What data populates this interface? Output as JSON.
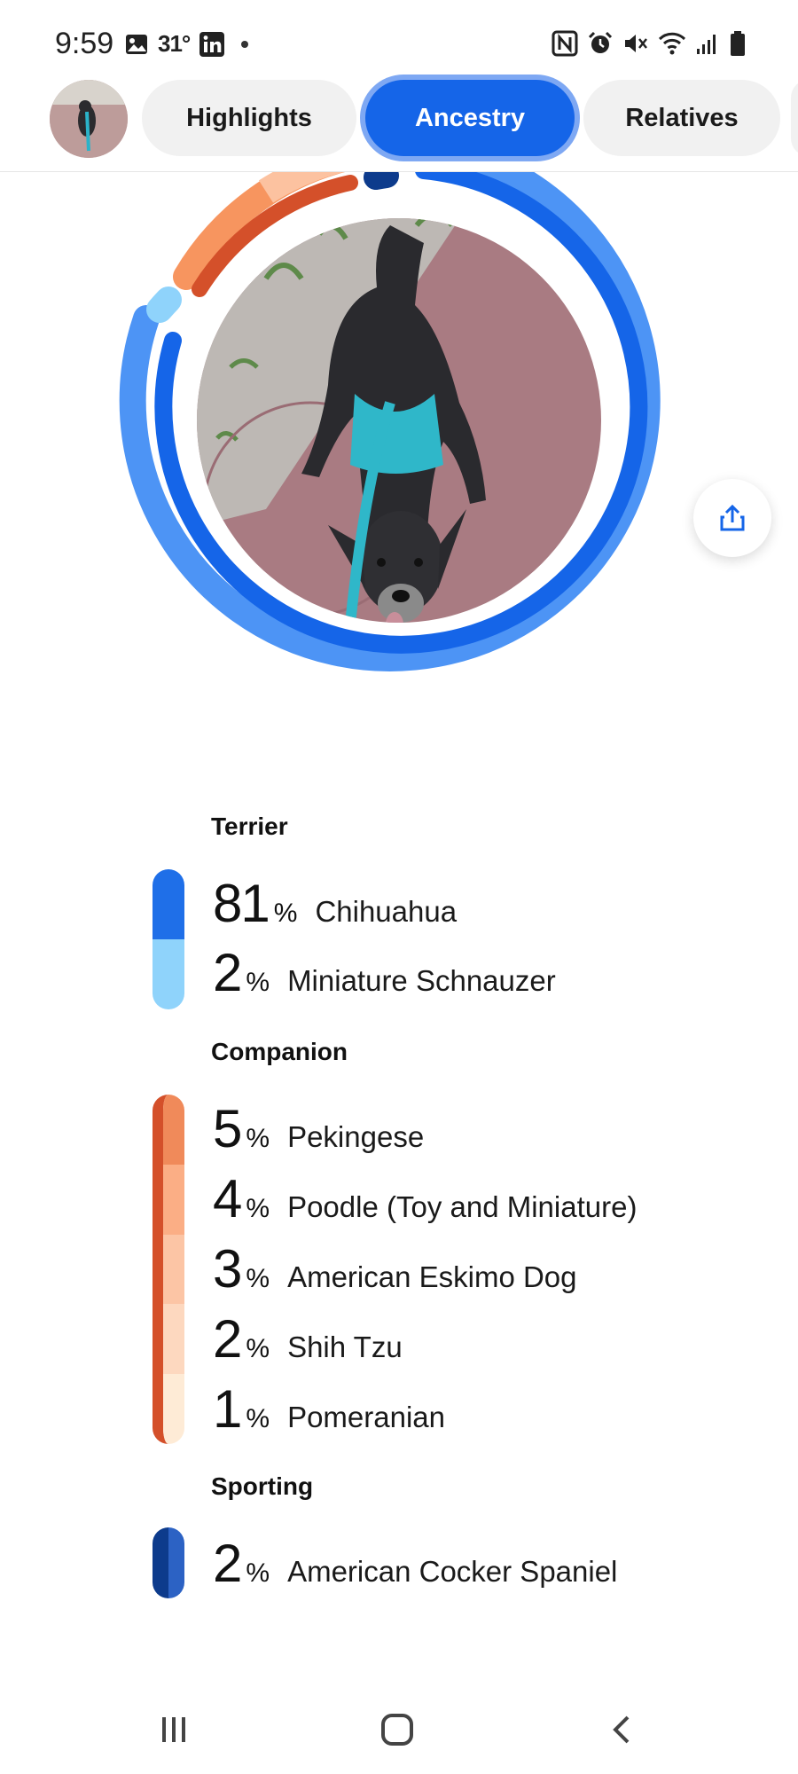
{
  "status_bar": {
    "time": "9:59",
    "temperature": "31°",
    "icons_left": [
      "gallery-icon",
      "linkedin-icon",
      "dot-icon"
    ],
    "icons_right": [
      "nfc-icon",
      "alarm-icon",
      "mute-icon",
      "wifi-icon",
      "signal-icon",
      "battery-icon"
    ]
  },
  "tabs": [
    {
      "label": "Highlights",
      "active": false
    },
    {
      "label": "Ancestry",
      "active": true
    },
    {
      "label": "Relatives",
      "active": false
    }
  ],
  "colors": {
    "accent": "#1565e8",
    "terrier": [
      "#1f6fe8",
      "#8fd3fb"
    ],
    "companion": [
      "#f08a5a",
      "#fbae85",
      "#fcc5a5",
      "#fdd8bf",
      "#feebd6"
    ],
    "companion_edge": "#d4502a",
    "sporting": [
      "#0d3b8c",
      "#2c62c4"
    ]
  },
  "ancestry": [
    {
      "group": "Terrier",
      "breeds": [
        {
          "pct": "81",
          "name": "Chihuahua"
        },
        {
          "pct": "2",
          "name": "Miniature Schnauzer"
        }
      ]
    },
    {
      "group": "Companion",
      "breeds": [
        {
          "pct": "5",
          "name": "Pekingese"
        },
        {
          "pct": "4",
          "name": "Poodle (Toy and Miniature)"
        },
        {
          "pct": "3",
          "name": "American Eskimo Dog"
        },
        {
          "pct": "2",
          "name": "Shih Tzu"
        },
        {
          "pct": "1",
          "name": "Pomeranian"
        }
      ]
    },
    {
      "group": "Sporting",
      "breeds": [
        {
          "pct": "2",
          "name": "American Cocker Spaniel"
        }
      ]
    }
  ],
  "percent_sign": "%",
  "nav": [
    "recent-apps-icon",
    "home-icon",
    "back-icon"
  ]
}
